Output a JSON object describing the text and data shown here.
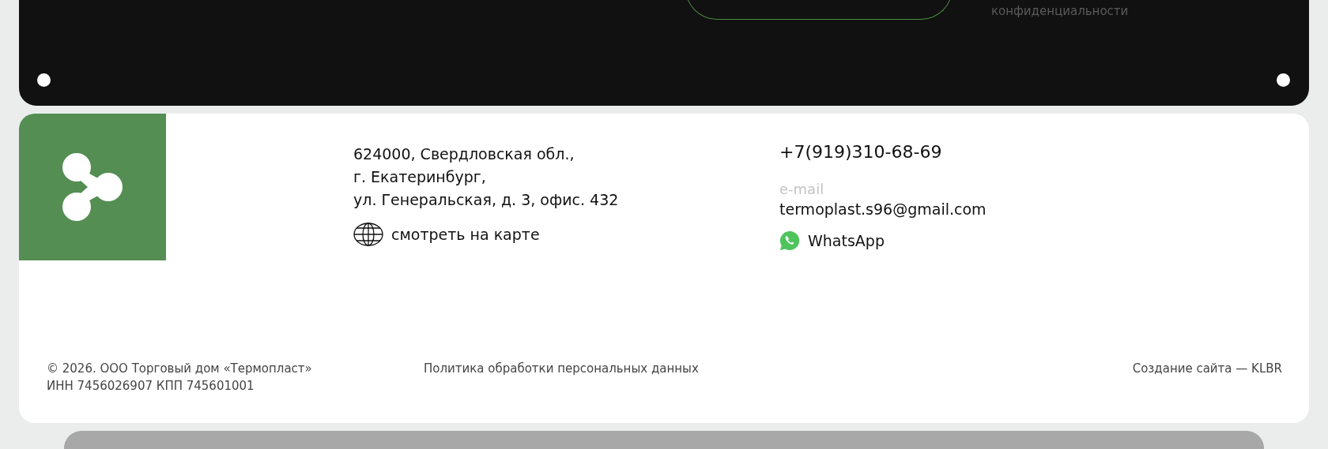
{
  "top_panel": {
    "policy_text_tail": "конфиденциальности"
  },
  "address": {
    "lines": [
      "624000, Свердловская обл.,",
      "г. Екатеринбург,",
      "ул. Генеральская, д. 3, офис. 432"
    ],
    "map_link": "смотреть на карте"
  },
  "contacts": {
    "phone": "+7(919)310-68-69",
    "email_label": "e-mail",
    "email": "termoplast.s96@gmail.com",
    "whatsapp": "WhatsApp"
  },
  "footer": {
    "copyright": "© 2026. ООО Торговый дом «Термопласт»",
    "requisites": "ИНН 7456026907 КПП 745601001",
    "privacy_link": "Политика обработки персональных данных",
    "credits": "Создание сайта — KLBR"
  }
}
